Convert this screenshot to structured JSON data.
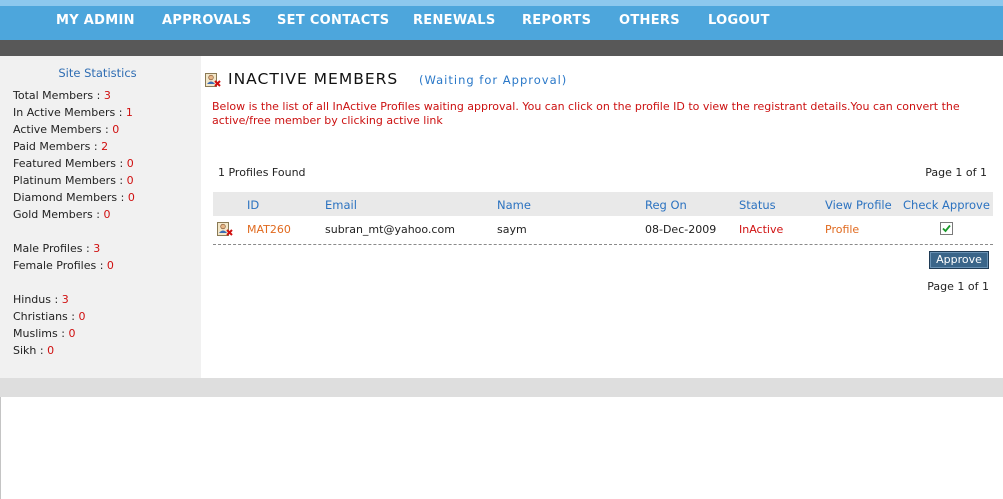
{
  "nav": {
    "items": [
      {
        "label": "MY ADMIN"
      },
      {
        "label": "APPROVALS"
      },
      {
        "label": "SET CONTACTS"
      },
      {
        "label": "RENEWALS"
      },
      {
        "label": "REPORTS"
      },
      {
        "label": "OTHERS"
      },
      {
        "label": "LOGOUT"
      }
    ]
  },
  "sidebar": {
    "title": "Site Statistics",
    "stats": [
      {
        "label": "Total Members : ",
        "value": "3"
      },
      {
        "label": "In Active Members : ",
        "value": "1"
      },
      {
        "label": "Active Members : ",
        "value": "0"
      },
      {
        "label": "Paid Members : ",
        "value": "2"
      },
      {
        "label": "Featured Members : ",
        "value": "0"
      },
      {
        "label": "Platinum Members : ",
        "value": "0"
      },
      {
        "label": "Diamond Members : ",
        "value": "0"
      },
      {
        "label": "Gold Members : ",
        "value": "0"
      },
      {
        "label": "Male Profiles : ",
        "value": "3"
      },
      {
        "label": "Female Profiles : ",
        "value": "0"
      },
      {
        "label": "Hindus : ",
        "value": "3"
      },
      {
        "label": "Christians : ",
        "value": "0"
      },
      {
        "label": "Muslims : ",
        "value": "0"
      },
      {
        "label": "Sikh : ",
        "value": "0"
      }
    ]
  },
  "main": {
    "title": "INACTIVE MEMBERS",
    "subtitle": "(Waiting for Approval)",
    "intro": "Below is the list of all InActive Profiles waiting approval. You can click on the profile ID to view the registrant details.You can convert the active/free member by clicking active link",
    "count_text": "1 Profiles Found",
    "page_info_top": "Page 1 of 1",
    "page_info_bottom": "Page 1 of 1",
    "approve_label": "Approve",
    "table": {
      "headers": [
        "ID",
        "Email",
        "Name",
        "Reg On",
        "Status",
        "View Profile",
        "Check Approve"
      ],
      "rows": [
        {
          "id": "MAT260",
          "email": "subran_mt@yahoo.com",
          "name": "saym",
          "reg_on": "08-Dec-2009",
          "status": "InActive",
          "view": "Profile",
          "checked": true
        }
      ]
    }
  }
}
